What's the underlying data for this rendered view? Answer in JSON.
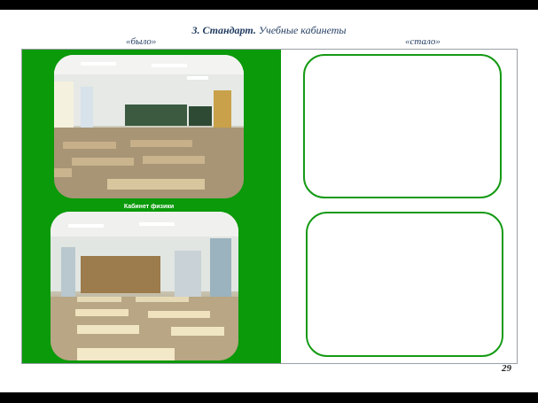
{
  "slide": {
    "title_number": "3.",
    "title_bold": "Стандарт.",
    "title_rest": "Учебные кабинеты",
    "label_before": "«было»",
    "label_after": "«стало»",
    "caption": "Кабинет физики",
    "page_number": "29"
  },
  "colors": {
    "panel_green": "#0a9a0a",
    "box_border": "#159a15",
    "title_text": "#1f3a5f"
  }
}
